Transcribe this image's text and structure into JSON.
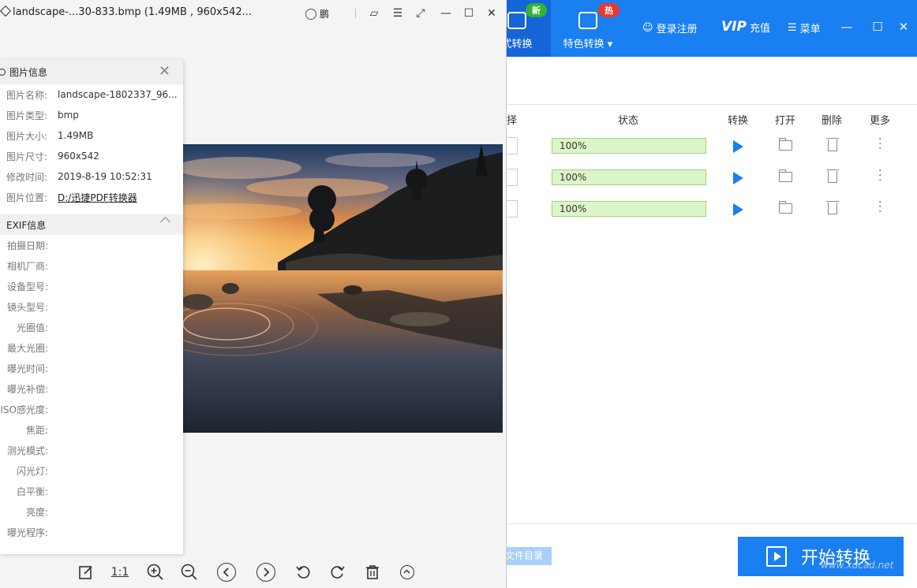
{
  "viewer": {
    "title": "landscape-...30-833.bmp (1.49MB , 960x542...",
    "user_name": "鹏",
    "info_panel": {
      "title": "图片信息",
      "rows": [
        {
          "key": "图片名称:",
          "value": "landscape-1802337_96..."
        },
        {
          "key": "图片类型:",
          "value": "bmp"
        },
        {
          "key": "图片大小:",
          "value": "1.49MB"
        },
        {
          "key": "图片尺寸:",
          "value": "960x542"
        },
        {
          "key": "修改时间:",
          "value": "2019-8-19 10:52:31"
        },
        {
          "key": "图片位置:",
          "value": "D:/迅捷PDF转换器"
        }
      ],
      "exif_title": "EXIF信息",
      "exif_rows": [
        "拍摄日期:",
        "相机厂商:",
        "设备型号:",
        "镜头型号:",
        "光圈值:",
        "最大光圈:",
        "曝光时间:",
        "曝光补偿:",
        "ISO感光度:",
        "焦距:",
        "测光模式:",
        "闪光灯:",
        "白平衡:",
        "亮度:",
        "曝光程序:"
      ]
    },
    "toolbar": {
      "actual_size": "1:1"
    }
  },
  "app": {
    "tabs": {
      "format": "式转换",
      "format_badge": "新",
      "special": "特色转换",
      "special_badge": "热"
    },
    "header": {
      "login": "登录注册",
      "vip": "VIP",
      "recharge": "充值",
      "menu": "菜单"
    },
    "table": {
      "col_select": "择",
      "col_status": "状态",
      "col_convert": "转换",
      "col_open": "打开",
      "col_delete": "删除",
      "col_more": "更多",
      "rows": [
        {
          "progress": "100%"
        },
        {
          "progress": "100%"
        },
        {
          "progress": "100%"
        }
      ]
    },
    "footer": {
      "dir_button": "文件目录",
      "start_button": "开始转换",
      "watermark": "www.xdcad.net"
    },
    "colors": {
      "accent": "#1a7ff0",
      "progress_fill": "#dcf5c8"
    }
  }
}
